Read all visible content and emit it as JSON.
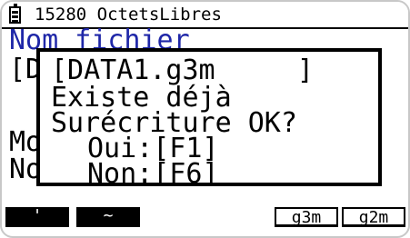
{
  "status_bar": {
    "battery_icon": "battery-icon",
    "free_memory_text": "15280 OctetsLibres"
  },
  "background": {
    "line1": "Nom fichier",
    "line2": "[D",
    "line3": "Mo",
    "line4": "No"
  },
  "dialog": {
    "filename_line": "[DATA1.g3m     ]",
    "message1": "Existe déjà",
    "message2": "Surécriture OK?",
    "yes_option": "Oui:[F1]",
    "no_option": "Non:[F6]"
  },
  "function_keys": {
    "f1": "'",
    "f2": "~",
    "f5": "g3m",
    "f6": "g2m"
  },
  "colors": {
    "header_text": "#1f27a8",
    "text": "#000000",
    "background": "#ffffff"
  }
}
